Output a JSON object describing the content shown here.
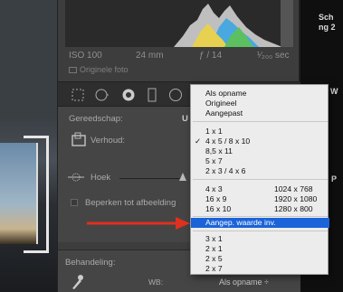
{
  "exif": {
    "iso": "ISO 100",
    "focal": "24 mm",
    "aperture": "ƒ / 14",
    "shutter": "¹⁄₂₀₀ sec"
  },
  "original_photo_label": "Originele foto",
  "tools_section": {
    "title": "Gereedschap:",
    "tool_suffix": "U",
    "aspect_label": "Verhoud:",
    "angle_label": "Hoek",
    "constrain_label": "Beperken tot afbeelding"
  },
  "treatment_section": {
    "title": "Behandeling:",
    "wb_label": "WB:",
    "wb_value": "Als opname ÷"
  },
  "right_text": [
    "Sch",
    "ng 2",
    "W",
    "P"
  ],
  "menu": {
    "group1": [
      "Als opname",
      "Origineel",
      "Aangepast"
    ],
    "group2": [
      {
        "label": "1 x 1",
        "checked": false
      },
      {
        "label": "4 x 5  /  8 x 10",
        "checked": true
      },
      {
        "label": "8,5 x 11",
        "checked": false
      },
      {
        "label": "5 x 7",
        "checked": false
      },
      {
        "label": "2 x 3  /  4 x 6",
        "checked": false
      }
    ],
    "group3": [
      {
        "label": "4 x 3",
        "res": "1024 x 768"
      },
      {
        "label": "16 x 9",
        "res": "1920 x 1080"
      },
      {
        "label": "16 x 10",
        "res": "1280 x 800"
      }
    ],
    "highlighted": "Aangep. waarde inv.",
    "group4": [
      "3 x 1",
      "2 x 1",
      "2 x 5",
      "2 x 7"
    ]
  },
  "colors": {
    "highlight": "#1b63d8",
    "arrow": "#e0301e"
  }
}
